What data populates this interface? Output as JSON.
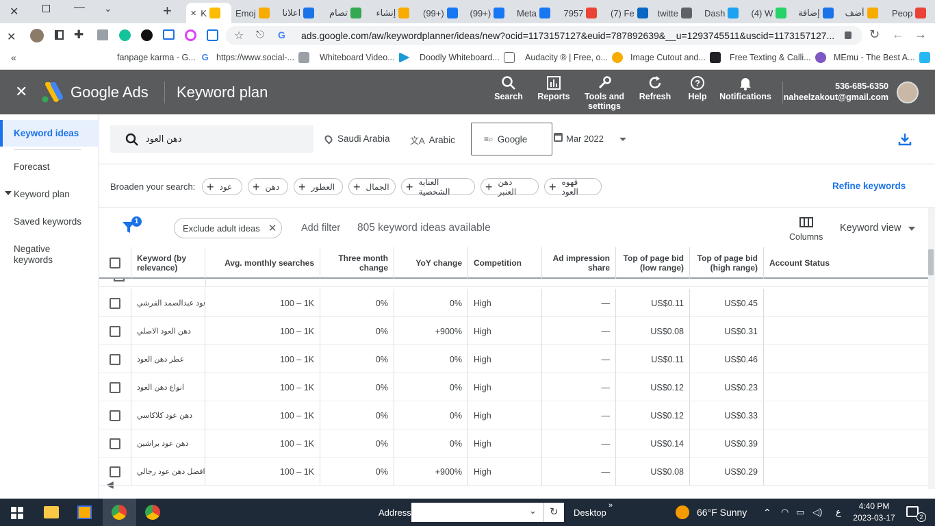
{
  "browser": {
    "tabs": [
      {
        "label": "K",
        "color": "#fbbc04"
      },
      {
        "label": "Emoj",
        "color": "#f9ab00"
      },
      {
        "label": "اعلانا",
        "color": "#1a73e8"
      },
      {
        "label": "تصام",
        "color": "#34a853"
      },
      {
        "label": "إنشاء",
        "color": "#f9ab00"
      },
      {
        "label": "(99+)",
        "color": "#1877f2"
      },
      {
        "label": "(99+)",
        "color": "#1877f2"
      },
      {
        "label": "Meta",
        "color": "#1877f2"
      },
      {
        "label": "7957",
        "color": "#ea4335"
      },
      {
        "label": "(7) Fe",
        "color": "#0a66c2"
      },
      {
        "label": "twitte",
        "color": "#5f6368"
      },
      {
        "label": "Dash",
        "color": "#1da1f2"
      },
      {
        "label": "(4) W",
        "color": "#25d366"
      },
      {
        "label": "إضافة",
        "color": "#1a73e8"
      },
      {
        "label": "أضف",
        "color": "#f9ab00"
      },
      {
        "label": "Peop",
        "color": "#ea4335"
      }
    ],
    "url": "ads.google.com/aw/keywordplanner/ideas/new?ocid=1173157127&euid=787892639&__u=1293745511&uscid=1173157127...",
    "bookmarks": [
      "fanpage karma - G...",
      "https://www.social-...",
      "Whiteboard Video...",
      "Doodly Whiteboard...",
      "Audacity ® | Free, o...",
      "Image Cutout and...",
      "Free Texting & Calli...",
      "MEmu - The Best A..."
    ]
  },
  "header": {
    "product": "Google Ads",
    "page_title": "Keyword plan",
    "buttons": {
      "search": "Search",
      "reports": "Reports",
      "tools": "Tools and settings",
      "refresh": "Refresh",
      "help": "Help",
      "notifications": "Notifications"
    },
    "account_id": "536-685-6350",
    "email": "naheelzakout@gmail.com"
  },
  "sidebar": {
    "items": [
      "Keyword ideas",
      "Forecast",
      "Keyword plan",
      "Saved keywords",
      "Negative keywords"
    ]
  },
  "search": {
    "query": "دهن العود",
    "location": "Saudi Arabia",
    "language": "Arabic",
    "network": "Google",
    "date": "Mar 2022"
  },
  "broaden": {
    "label": "Broaden your search:",
    "chips": [
      "عود",
      "دهن",
      "العطور",
      "الجمال",
      "العناية الشخصية",
      "دهن العنبر",
      "قهوه العود"
    ],
    "refine": "Refine keywords"
  },
  "filters": {
    "badge": "1",
    "exclude_chip": "Exclude adult ideas",
    "add_filter": "Add filter",
    "count_text": "805 keyword ideas available",
    "columns": "Columns",
    "view": "Keyword view"
  },
  "table": {
    "columns": [
      "Keyword (by relevance)",
      "Avg. monthly searches",
      "Three month change",
      "YoY change",
      "Competition",
      "Ad impression share",
      "Top of page bid (low range)",
      "Top of page bid (high range)",
      "Account Status"
    ],
    "rows": [
      [
        "دهن عود عبدالصمد القرشي",
        "100 – 1K",
        "0%",
        "0%",
        "High",
        "—",
        "US$0.11",
        "US$0.45"
      ],
      [
        "دهن العود الاصلي",
        "100 – 1K",
        "0%",
        "+900%",
        "High",
        "—",
        "US$0.08",
        "US$0.31"
      ],
      [
        "عطر دهن العود",
        "100 – 1K",
        "0%",
        "0%",
        "High",
        "—",
        "US$0.11",
        "US$0.46"
      ],
      [
        "انواع دهن العود",
        "100 – 1K",
        "0%",
        "0%",
        "High",
        "—",
        "US$0.12",
        "US$0.23"
      ],
      [
        "دهن عود كلاكاسي",
        "100 – 1K",
        "0%",
        "0%",
        "High",
        "—",
        "US$0.12",
        "US$0.33"
      ],
      [
        "دهن عود براشين",
        "100 – 1K",
        "0%",
        "0%",
        "High",
        "—",
        "US$0.14",
        "US$0.39"
      ],
      [
        "افضل دهن عود رجالي",
        "100 – 1K",
        "0%",
        "+900%",
        "High",
        "—",
        "US$0.08",
        "US$0.29"
      ]
    ]
  },
  "taskbar": {
    "address_label": "Address",
    "desktop_label": "Desktop",
    "weather": "66°F  Sunny",
    "lang": "ع",
    "time": "4:40 PM",
    "date": "2023-03-17",
    "notif_count": "2"
  }
}
